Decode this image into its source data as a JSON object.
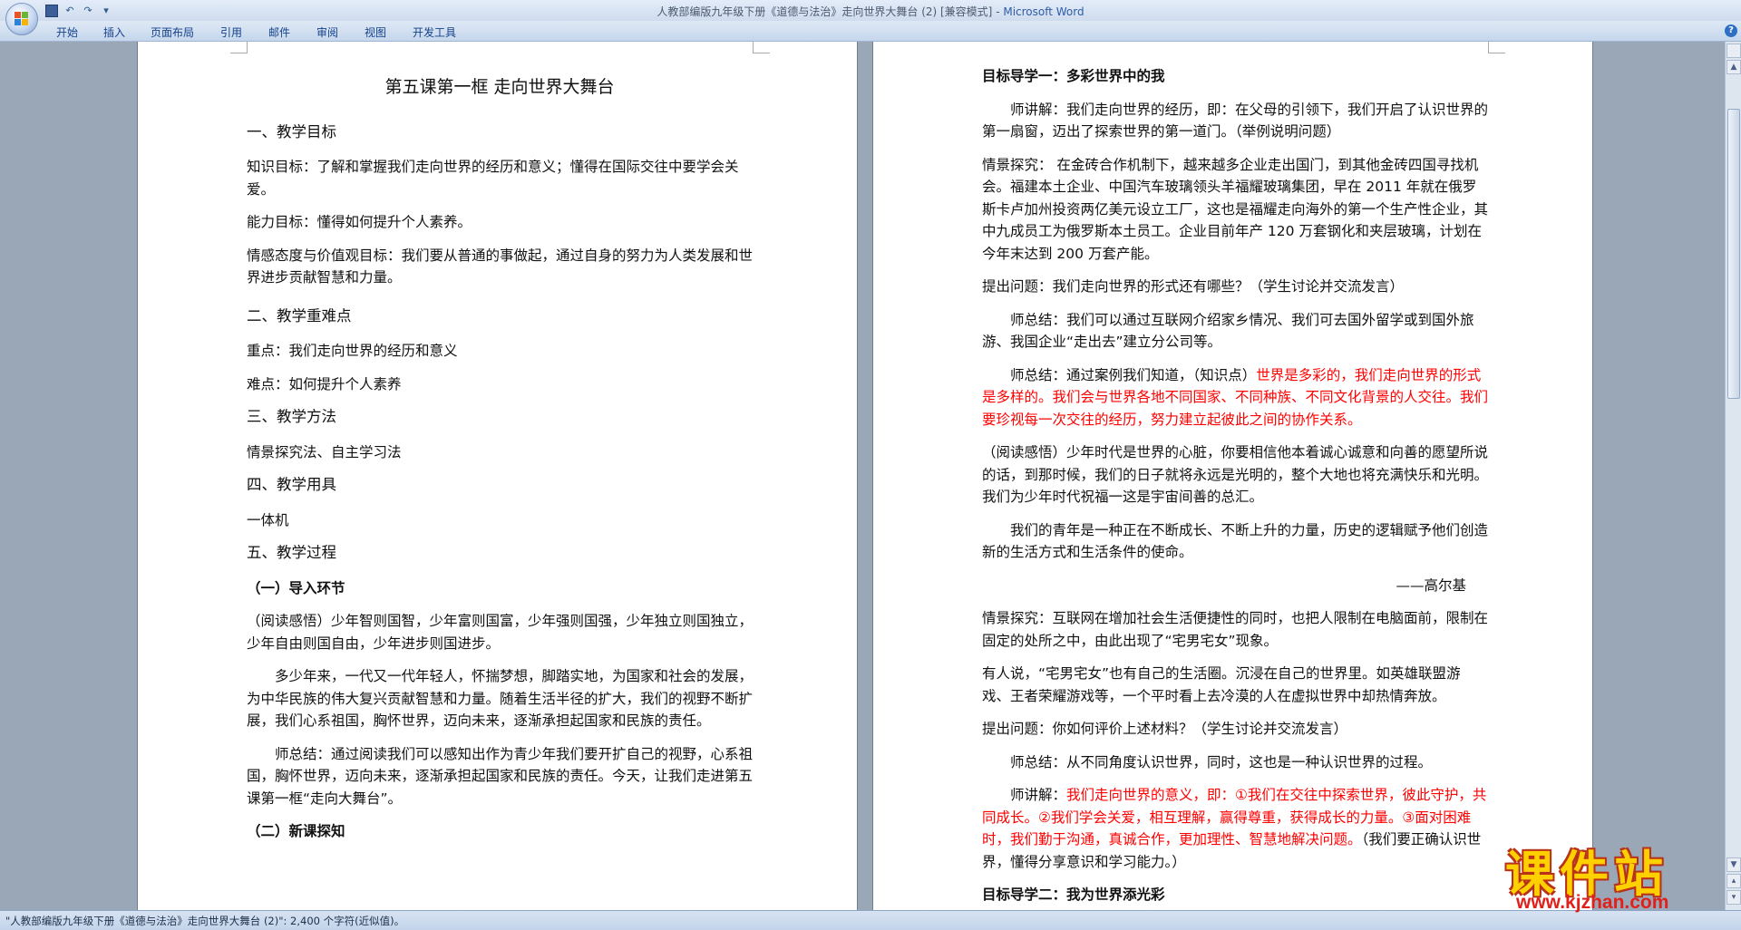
{
  "window": {
    "title_doc": "人教部编版九年级下册《道德与法治》走向世界大舞台 (2) [兼容模式]",
    "title_sep": " - ",
    "title_app": "Microsoft Word"
  },
  "ribbon": {
    "tabs": [
      "开始",
      "插入",
      "页面布局",
      "引用",
      "邮件",
      "审阅",
      "视图",
      "开发工具"
    ],
    "help": "?"
  },
  "quick_access": {
    "undo": "↶",
    "redo": "↷",
    "more": "▾"
  },
  "page1": {
    "title": "第五课第一框    走向世界大舞台",
    "h1": "一、教学目标",
    "goal_knowledge": "知识目标：了解和掌握我们走向世界的经历和意义；懂得在国际交往中要学会关爱。",
    "goal_ability": "能力目标：懂得如何提升个人素养。",
    "goal_emotion": "情感态度与价值观目标：我们要从普通的事做起，通过自身的努力为人类发展和世界进步贡献智慧和力量。",
    "h2": "二、教学重难点",
    "key_point": "重点：我们走向世界的经历和意义",
    "difficult_point": "难点：如何提升个人素养",
    "h3": "三、教学方法",
    "methods": "情景探究法、自主学习法",
    "h4": "四、教学用具",
    "tools": "一体机",
    "h5": "五、教学过程",
    "sub1": "（一）导入环节",
    "reading": "（阅读感悟）少年智则国智，少年富则国富，少年强则国强，少年独立则国独立，少年自由则国自由，少年进步则国进步。",
    "para_years": "多少年来，一代又一代年轻人，怀揣梦想，脚踏实地，为国家和社会的发展，为中华民族的伟大复兴贡献智慧和力量。随着生活半径的扩大，我们的视野不断扩展，我们心系祖国，胸怀世界，迈向未来，逐渐承担起国家和民族的责任。",
    "teacher_summary": "师总结：通过阅读我们可以感知出作为青少年我们要开扩自己的视野，心系祖国，胸怀世界，迈向未来，逐渐承担起国家和民族的责任。今天，让我们走进第五课第一框“走向大舞台”。",
    "sub2": "（二）新课探知"
  },
  "page2": {
    "guide1": "目标导学一：多彩世界中的我",
    "lecture1": "师讲解：我们走向世界的经历，即：在父母的引领下，我们开启了认识世界的第一扇窗，迈出了探索世界的第一道门。（举例说明问题）",
    "scenario1": "情景探究：  在金砖合作机制下，越来越多企业走出国门，到其他金砖四国寻找机会。福建本土企业、中国汽车玻璃领头羊福耀玻璃集团，早在 2011 年就在俄罗斯卡卢加州投资两亿美元设立工厂，这也是福耀走向海外的第一个生产性企业，其中九成员工为俄罗斯本土员工。企业目前年产 120 万套钢化和夹层玻璃，计划在今年末达到 200 万套产能。",
    "question1": "提出问题：我们走向世界的形式还有哪些？（学生讨论并交流发言）",
    "summary1": "师总结：我们可以通过互联网介绍家乡情况、我们可去国外留学或到国外旅游、我国企业“走出去”建立分公司等。",
    "summary2_prefix": "师总结：通过案例我们知道，（知识点）",
    "summary2_red": "世界是多彩的，我们走向世界的形式是多样的。我们会与世界各地不同国家、不同种族、不同文化背景的人交往。我们要珍视每一次交往的经历，努力建立起彼此之间的协作关系。",
    "reading2": "（阅读感悟）少年时代是世界的心脏，你要相信他本着诚心诚意和向善的愿望所说的话，到那时候，我们的日子就将永远是光明的，整个大地也将充满快乐和光明。我们为少年时代祝福一这是宇宙间善的总汇。",
    "youth": "我们的青年是一种正在不断成长、不断上升的力量，历史的逻辑赋予他们创造新的生活方式和生活条件的使命。",
    "author": "——高尔基",
    "scenario2": "情景探究：互联网在增加社会生活便捷性的同时，也把人限制在电脑面前，限制在固定的处所之中，由此出现了“宅男宅女”现象。",
    "opinion": "有人说，“宅男宅女”也有自己的生活圈。沉浸在自己的世界里。如英雄联盟游戏、王者荣耀游戏等，一个平时看上去冷漠的人在虚拟世界中却热情奔放。",
    "question2": "提出问题：你如何评价上述材料？（学生讨论并交流发言）",
    "summary3": "师总结：从不同角度认识世界，同时，这也是一种认识世界的过程。",
    "lecture2_prefix": "师讲解：",
    "lecture2_red": "我们走向世界的意义，即：①我们在交往中探索世界，彼此守护，共同成长。②我们学会关爱，相互理解，赢得尊重，获得成长的力量。③面对困难时，我们勤于沟通，真诚合作，更加理性、智慧地解决问题。",
    "lecture2_suffix": "（我们要正确认识世界，懂得分享意识和学习能力。）",
    "guide2": "目标导学二：我为世界添光彩"
  },
  "status": {
    "text": "\"人教部编版九年级下册《道德与法治》走向世界大舞台 (2)\": 2,400 个字符(近似值)。"
  },
  "watermark": {
    "main": "课件站",
    "url": "www.kjzhan.com"
  },
  "colors": {
    "accent_red": "#ff0000",
    "watermark_yellow": "#ffd000"
  }
}
